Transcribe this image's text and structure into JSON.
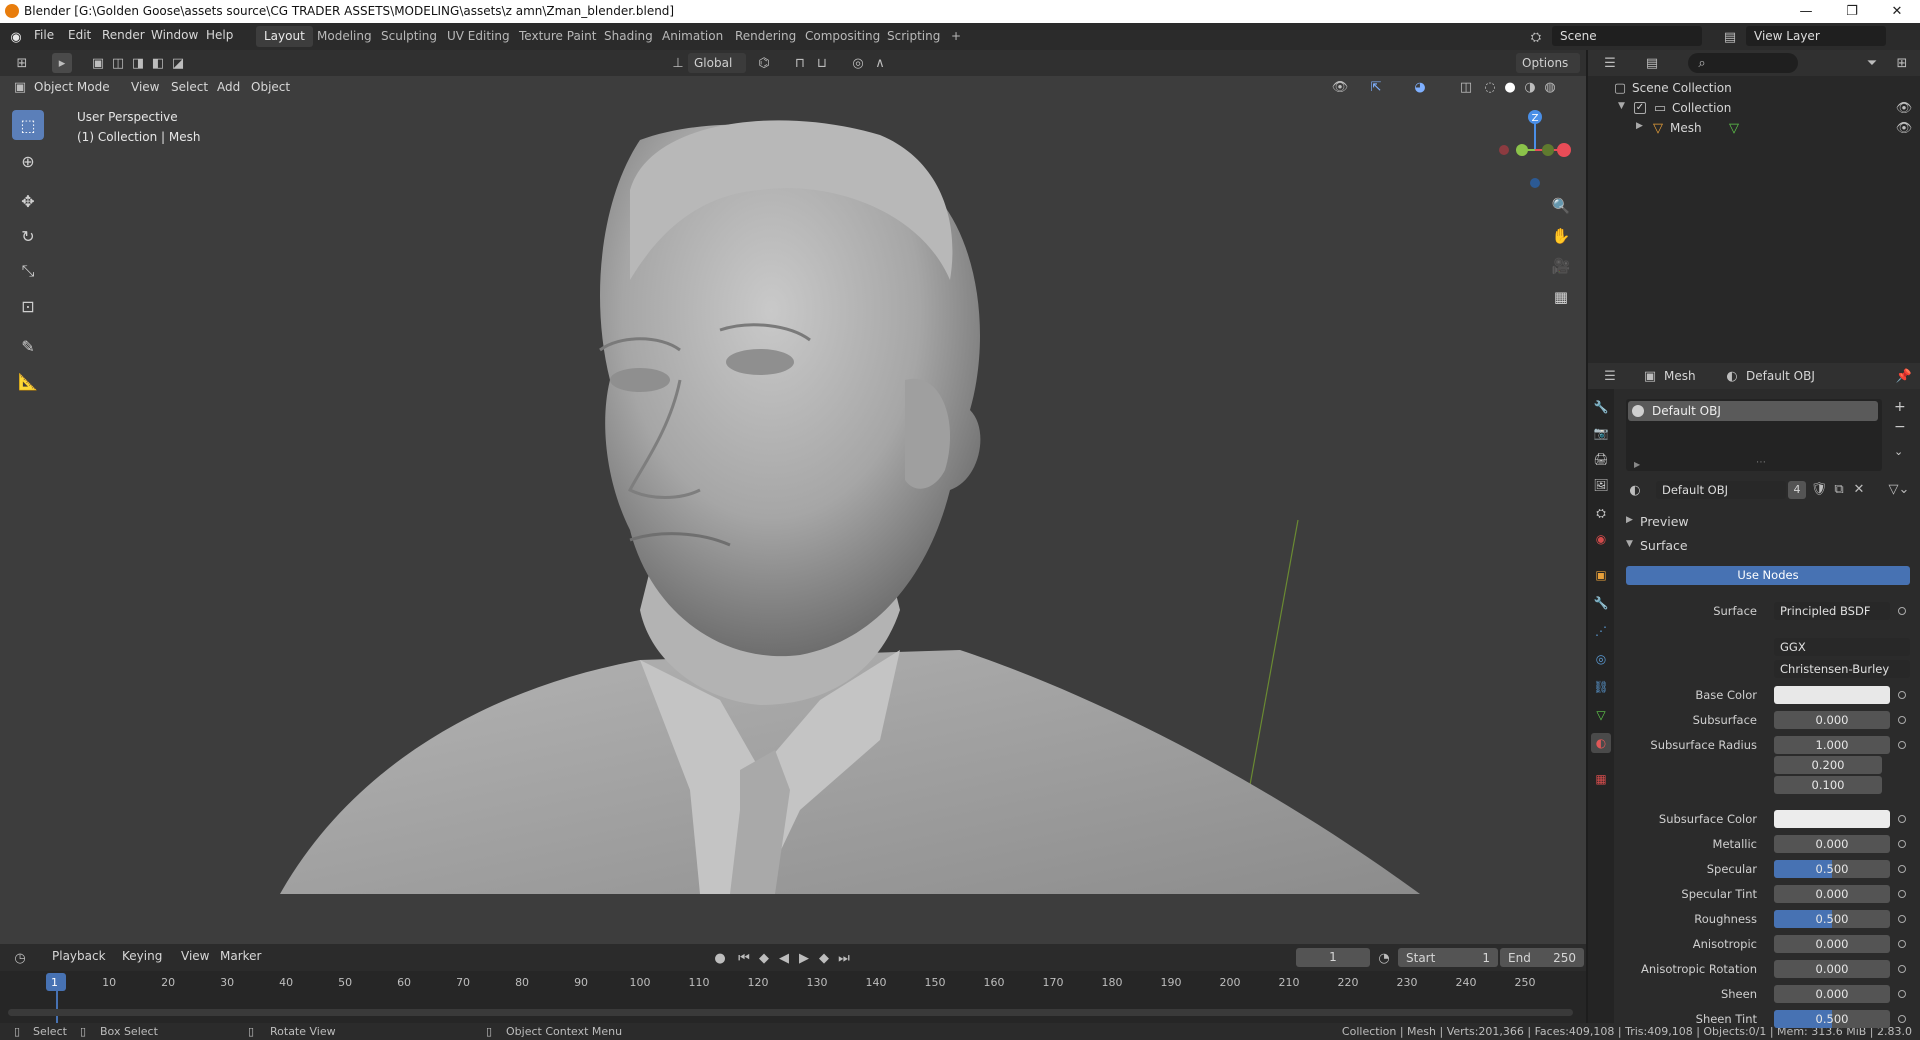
{
  "window": {
    "title": "Blender [G:\\Golden Goose\\assets source\\CG TRADER ASSETS\\MODELING\\assets\\z amn\\Zman_blender.blend]",
    "minimize": "—",
    "maximize": "❐",
    "close": "✕"
  },
  "menubar": {
    "menus": [
      "File",
      "Edit",
      "Render",
      "Window",
      "Help"
    ],
    "workspaces": [
      "Layout",
      "Modeling",
      "Sculpting",
      "UV Editing",
      "Texture Paint",
      "Shading",
      "Animation",
      "Rendering",
      "Compositing",
      "Scripting"
    ],
    "active_workspace": "Layout",
    "add_workspace": "+",
    "scene_label": "Scene",
    "view_layer_label": "View Layer"
  },
  "viewport": {
    "transform_orientation": "Global",
    "options_label": "Options",
    "mode": "Object Mode",
    "menus": [
      "View",
      "Select",
      "Add",
      "Object"
    ],
    "overlay_line1": "User Perspective",
    "overlay_line2": "(1) Collection | Mesh",
    "gizmo_z": "Z"
  },
  "outliner": {
    "scene_collection": "Scene Collection",
    "collection": "Collection",
    "mesh": "Mesh"
  },
  "properties": {
    "breadcrumb_object": "Mesh",
    "breadcrumb_material": "Default OBJ",
    "slot_name": "Default OBJ",
    "material_name": "Default OBJ",
    "user_count": "4",
    "panel_preview": "Preview",
    "panel_surface": "Surface",
    "use_nodes": "Use Nodes",
    "surface_label": "Surface",
    "surface_shader": "Principled BSDF",
    "distribution": "GGX",
    "subsurface_method": "Christensen-Burley",
    "rows": [
      {
        "label": "Base Color",
        "type": "color",
        "color": "#e8e8e8"
      },
      {
        "label": "Subsurface",
        "value": "0.000",
        "fill": 0
      },
      {
        "label": "Subsurface Radius",
        "value": "1.000",
        "fill": 0,
        "extra": [
          "0.200",
          "0.100"
        ]
      },
      {
        "label": "Subsurface Color",
        "type": "color",
        "color": "#ececec"
      },
      {
        "label": "Metallic",
        "value": "0.000",
        "fill": 0
      },
      {
        "label": "Specular",
        "value": "0.500",
        "fill": 0.5
      },
      {
        "label": "Specular Tint",
        "value": "0.000",
        "fill": 0
      },
      {
        "label": "Roughness",
        "value": "0.500",
        "fill": 0.5
      },
      {
        "label": "Anisotropic",
        "value": "0.000",
        "fill": 0
      },
      {
        "label": "Anisotropic Rotation",
        "value": "0.000",
        "fill": 0
      },
      {
        "label": "Sheen",
        "value": "0.000",
        "fill": 0
      },
      {
        "label": "Sheen Tint",
        "value": "0.500",
        "fill": 0.5
      }
    ]
  },
  "timeline": {
    "menus": [
      "Playback",
      "Keying",
      "View",
      "Marker"
    ],
    "current_frame": "1",
    "start_label": "Start",
    "start": "1",
    "end_label": "End",
    "end": "250",
    "ticks": [
      "1",
      "10",
      "20",
      "30",
      "40",
      "50",
      "60",
      "70",
      "80",
      "90",
      "100",
      "110",
      "120",
      "130",
      "140",
      "150",
      "160",
      "170",
      "180",
      "190",
      "200",
      "210",
      "220",
      "230",
      "240",
      "250"
    ]
  },
  "statusbar": {
    "select": "Select",
    "box_select": "Box Select",
    "rotate_view": "Rotate View",
    "context_menu": "Object Context Menu",
    "stats": "Collection | Mesh | Verts:201,366 | Faces:409,108 | Tris:409,108 | Objects:0/1 | Mem: 313.6 MiB | 2.83.0"
  },
  "colors": {
    "accent": "#4772b3",
    "active_tool": "#5b7fb9",
    "viewport_bg": "#3d3d3d",
    "panel_bg": "#2b2b2b"
  }
}
